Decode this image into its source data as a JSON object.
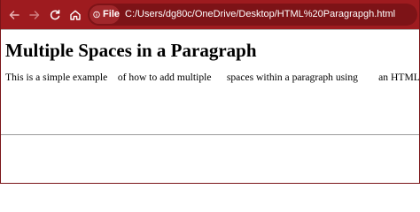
{
  "browser": {
    "address_bar": {
      "scheme_label": "File",
      "url": "C:/Users/dg80c/OneDrive/Desktop/HTML%20Paragrapgh.html"
    },
    "colors": {
      "toolbar": "#9e1b1f",
      "address_bar": "#7d1317"
    },
    "icons": [
      "back-arrow-icon",
      "forward-arrow-icon",
      "reload-icon",
      "home-icon",
      "info-icon"
    ]
  },
  "page": {
    "heading": "Multiple Spaces in a Paragraph",
    "paragraph": "This is a simple example    of how to add multiple      spaces within a paragraph using        an HTML entity &nbsp;."
  }
}
